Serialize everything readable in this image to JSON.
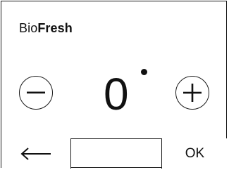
{
  "header": {
    "title_light": "Bio",
    "title_bold": "Fresh"
  },
  "temperature": {
    "value": "0",
    "unit_icon": "degree-dot"
  },
  "controls": {
    "decrease_icon": "minus-icon",
    "increase_icon": "plus-icon"
  },
  "footer": {
    "back_icon": "arrow-left-icon",
    "ok_label": "OK"
  }
}
